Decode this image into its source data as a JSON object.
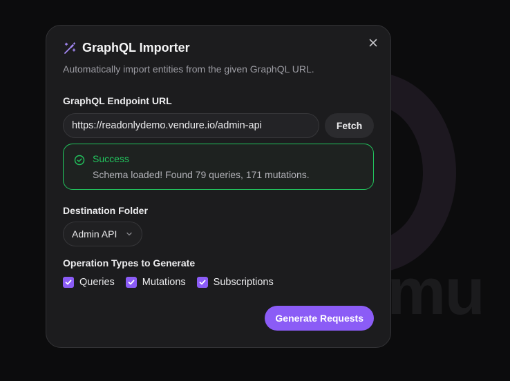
{
  "background": {
    "text": "mu"
  },
  "dialog": {
    "title": "GraphQL Importer",
    "subtitle": "Automatically import entities from the given GraphQL URL.",
    "title_icon": "magic-wand-icon",
    "close_icon": "close-icon"
  },
  "endpoint": {
    "label": "GraphQL Endpoint URL",
    "value": "https://readonlydemo.vendure.io/admin-api",
    "fetch_label": "Fetch"
  },
  "alert": {
    "title": "Success",
    "message": "Schema loaded! Found 79 queries, 171 mutations.",
    "icon": "check-circle-icon",
    "color": "#22c55e"
  },
  "folder": {
    "label": "Destination Folder",
    "selected": "Admin API"
  },
  "operations": {
    "label": "Operation Types to Generate",
    "items": [
      {
        "label": "Queries",
        "checked": true
      },
      {
        "label": "Mutations",
        "checked": true
      },
      {
        "label": "Subscriptions",
        "checked": true
      }
    ]
  },
  "actions": {
    "generate_label": "Generate Requests"
  },
  "colors": {
    "accent": "#8b5cf6",
    "success": "#22c55e",
    "surface": "#1c1c1e"
  }
}
